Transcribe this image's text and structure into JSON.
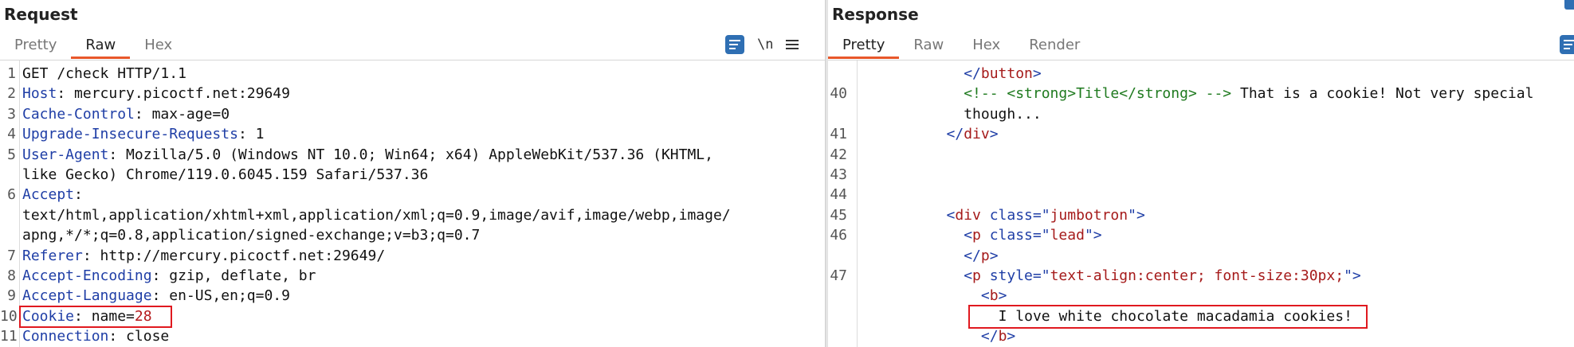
{
  "request": {
    "title": "Request",
    "tabs": [
      "Pretty",
      "Raw",
      "Hex"
    ],
    "active_tab": "Raw",
    "tools": {
      "newline_label": "\\n"
    },
    "lines": [
      {
        "n": "1",
        "h": "",
        "v": "GET /check HTTP/1.1"
      },
      {
        "n": "2",
        "h": "Host",
        "v": " mercury.picoctf.net:29649"
      },
      {
        "n": "3",
        "h": "Cache-Control",
        "v": " max-age=0"
      },
      {
        "n": "4",
        "h": "Upgrade-Insecure-Requests",
        "v": " 1"
      },
      {
        "n": "5",
        "h": "User-Agent",
        "v": " Mozilla/5.0 (Windows NT 10.0; Win64; x64) AppleWebKit/537.36 (KHTML,"
      },
      {
        "n": "",
        "h": "",
        "v": "like Gecko) Chrome/119.0.6045.159 Safari/537.36"
      },
      {
        "n": "6",
        "h": "Accept",
        "v": ""
      },
      {
        "n": "",
        "h": "",
        "v": "text/html,application/xhtml+xml,application/xml;q=0.9,image/avif,image/webp,image/"
      },
      {
        "n": "",
        "h": "",
        "v": "apng,*/*;q=0.8,application/signed-exchange;v=b3;q=0.7"
      },
      {
        "n": "7",
        "h": "Referer",
        "v": " http://mercury.picoctf.net:29649/"
      },
      {
        "n": "8",
        "h": "Accept-Encoding",
        "v": " gzip, deflate, br"
      },
      {
        "n": "9",
        "h": "Accept-Language",
        "v": " en-US,en;q=0.9"
      },
      {
        "n": "10",
        "h": "Cookie",
        "v": " name=",
        "r": "28"
      },
      {
        "n": "11",
        "h": "Connection",
        "v": " close"
      }
    ]
  },
  "response": {
    "title": "Response",
    "tabs": [
      "Pretty",
      "Raw",
      "Hex",
      "Render"
    ],
    "active_tab": "Pretty",
    "lines": [
      {
        "n": "",
        "indent": 6,
        "parts": [
          [
            "tag",
            "</"
          ],
          [
            "tagname",
            "button"
          ],
          [
            "tag",
            ">"
          ]
        ]
      },
      {
        "n": "40",
        "indent": 6,
        "parts": [
          [
            "comm",
            "<!-- <strong>Title</strong> -->"
          ],
          [
            "val",
            " That is a cookie! Not very special"
          ]
        ]
      },
      {
        "n": "",
        "indent": 6,
        "parts": [
          [
            "val",
            "though..."
          ]
        ]
      },
      {
        "n": "41",
        "indent": 5,
        "parts": [
          [
            "tag",
            "</"
          ],
          [
            "tagname",
            "div"
          ],
          [
            "tag",
            ">"
          ]
        ]
      },
      {
        "n": "42",
        "indent": 0,
        "parts": []
      },
      {
        "n": "43",
        "indent": 0,
        "parts": []
      },
      {
        "n": "44",
        "indent": 0,
        "parts": []
      },
      {
        "n": "45",
        "indent": 5,
        "parts": [
          [
            "tag",
            "<"
          ],
          [
            "tagname",
            "div"
          ],
          [
            "attr",
            " class"
          ],
          [
            "tag",
            "=\""
          ],
          [
            "attrv",
            "jumbotron"
          ],
          [
            "tag",
            "\">"
          ]
        ]
      },
      {
        "n": "46",
        "indent": 6,
        "parts": [
          [
            "tag",
            "<"
          ],
          [
            "tagname",
            "p"
          ],
          [
            "attr",
            " class"
          ],
          [
            "tag",
            "=\""
          ],
          [
            "attrv",
            "lead"
          ],
          [
            "tag",
            "\">"
          ]
        ]
      },
      {
        "n": "",
        "indent": 6,
        "parts": [
          [
            "tag",
            "</"
          ],
          [
            "tagname",
            "p"
          ],
          [
            "tag",
            ">"
          ]
        ]
      },
      {
        "n": "47",
        "indent": 6,
        "parts": [
          [
            "tag",
            "<"
          ],
          [
            "tagname",
            "p"
          ],
          [
            "attr",
            " style"
          ],
          [
            "tag",
            "=\""
          ],
          [
            "attrv",
            "text-align:center; font-size:30px;"
          ],
          [
            "tag",
            "\">"
          ]
        ]
      },
      {
        "n": "",
        "indent": 7,
        "parts": [
          [
            "tag",
            "<"
          ],
          [
            "tagname",
            "b"
          ],
          [
            "tag",
            ">"
          ]
        ]
      },
      {
        "n": "",
        "indent": 8,
        "parts": [
          [
            "val",
            "I love white chocolate macadamia cookies!"
          ]
        ]
      },
      {
        "n": "",
        "indent": 7,
        "parts": [
          [
            "tag",
            "</"
          ],
          [
            "tagname",
            "b"
          ],
          [
            "tag",
            ">"
          ]
        ]
      }
    ]
  }
}
